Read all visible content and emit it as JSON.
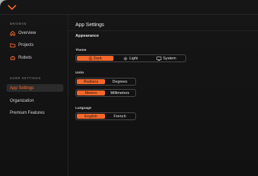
{
  "sidebar": {
    "browse_title": "BROWSE",
    "browse_items": [
      {
        "label": "Overview",
        "icon": "home-icon"
      },
      {
        "label": "Projects",
        "icon": "folder-icon"
      },
      {
        "label": "Robots",
        "icon": "robot-icon"
      }
    ],
    "settings_title": "USER SETTINGS",
    "settings_items": [
      {
        "label": "App Settings",
        "active": true
      },
      {
        "label": "Organization",
        "active": false
      },
      {
        "label": "Premium Features",
        "active": false
      }
    ]
  },
  "main": {
    "title": "App Settings",
    "section": "Appearance",
    "theme": {
      "label": "Theme",
      "options": [
        {
          "label": "Dark",
          "icon": "moon-icon",
          "selected": true
        },
        {
          "label": "Light",
          "icon": "sun-icon",
          "selected": false
        },
        {
          "label": "System",
          "icon": "monitor-icon",
          "selected": false
        }
      ]
    },
    "units": {
      "label": "Units",
      "angle": [
        {
          "label": "Radians",
          "selected": true
        },
        {
          "label": "Degrees",
          "selected": false
        }
      ],
      "length": [
        {
          "label": "Meters",
          "selected": true
        },
        {
          "label": "Millimeters",
          "selected": false
        }
      ]
    },
    "language": {
      "label": "Language",
      "options": [
        {
          "label": "English",
          "selected": true
        },
        {
          "label": "French",
          "selected": false
        }
      ]
    }
  },
  "colors": {
    "accent": "#f4672a",
    "background": "#141414",
    "active_nav": "#2b2b2b"
  }
}
